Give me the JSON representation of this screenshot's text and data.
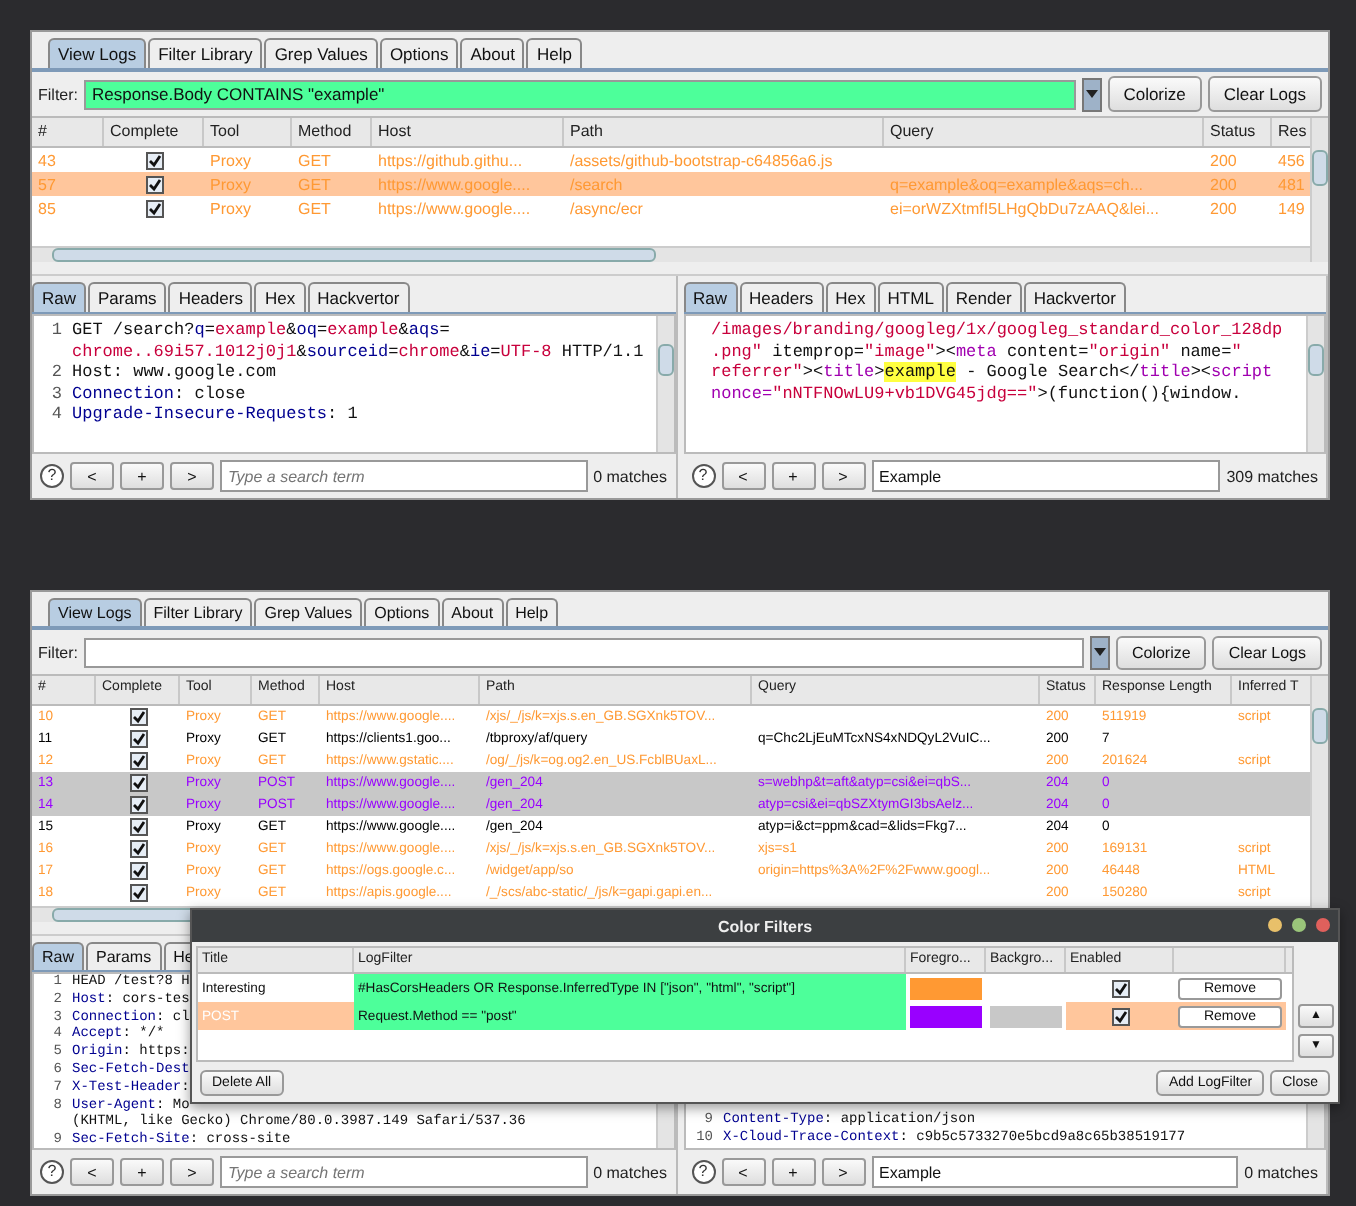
{
  "panels": [
    {
      "tabs": [
        {
          "label": "View Logs",
          "selected": true
        },
        {
          "label": "Filter Library",
          "selected": false
        },
        {
          "label": "Grep Values",
          "selected": false
        },
        {
          "label": "Options",
          "selected": false
        },
        {
          "label": "About",
          "selected": false
        },
        {
          "label": "Help",
          "selected": false
        }
      ],
      "filter": {
        "label": "Filter:",
        "value": "Response.Body CONTAINS \"example\"",
        "valid": true
      },
      "buttons": [
        "Colorize",
        "Clear Logs"
      ],
      "table": {
        "columns": [
          "#",
          "Complete",
          "Tool",
          "Method",
          "Host",
          "Path",
          "Query",
          "Status",
          "Res"
        ],
        "rows": [
          {
            "cells": [
              "43",
              "",
              "Proxy",
              "GET",
              "https://github.githu...",
              "/assets/github-bootstrap-c64856a6.js",
              "",
              "200",
              "456"
            ],
            "complete": true,
            "selected": false,
            "color": "#ff9933"
          },
          {
            "cells": [
              "57",
              "",
              "Proxy",
              "GET",
              "https://www.google....",
              "/search",
              "q=example&oq=example&aqs=ch...",
              "200",
              "481"
            ],
            "complete": true,
            "selected": true,
            "color": "#ff9933"
          },
          {
            "cells": [
              "85",
              "",
              "Proxy",
              "GET",
              "https://www.google....",
              "/async/ecr",
              "ei=orWZXtmfI5LHgQbDu7zAAQ&lei...",
              "200",
              "149"
            ],
            "complete": true,
            "selected": false,
            "color": "#ff9933"
          }
        ]
      },
      "request": {
        "tabs": [
          {
            "label": "Raw",
            "selected": true
          },
          {
            "label": "Params",
            "selected": false
          },
          {
            "label": "Headers",
            "selected": false
          },
          {
            "label": "Hex",
            "selected": false
          },
          {
            "label": "Hackvertor",
            "selected": false
          }
        ],
        "lines": [
          {
            "number": "1",
            "segments": [
              {
                "text": "GET /search?",
                "kind": "text"
              },
              {
                "text": "q",
                "kind": "name"
              },
              {
                "text": "=",
                "kind": "text"
              },
              {
                "text": "example",
                "kind": "value"
              },
              {
                "text": "&",
                "kind": "text"
              },
              {
                "text": "oq",
                "kind": "name"
              },
              {
                "text": "=",
                "kind": "text"
              },
              {
                "text": "example",
                "kind": "value"
              },
              {
                "text": "&",
                "kind": "text"
              },
              {
                "text": "aqs",
                "kind": "name"
              },
              {
                "text": "=",
                "kind": "text"
              }
            ]
          },
          {
            "segments": [
              {
                "text": "chrome..69i57.1012j0j1",
                "kind": "value"
              },
              {
                "text": "&",
                "kind": "text"
              },
              {
                "text": "sourceid",
                "kind": "name"
              },
              {
                "text": "=",
                "kind": "text"
              },
              {
                "text": "chrome",
                "kind": "value"
              },
              {
                "text": "&",
                "kind": "text"
              },
              {
                "text": "ie",
                "kind": "name"
              },
              {
                "text": "=",
                "kind": "text"
              },
              {
                "text": "UTF-8",
                "kind": "value"
              },
              {
                "text": " HTTP/1.1",
                "kind": "text"
              }
            ]
          },
          {
            "number": "2",
            "segments": [
              {
                "text": "Host: www.google.com",
                "kind": "text"
              }
            ]
          },
          {
            "number": "3",
            "segments": [
              {
                "text": "Connection",
                "kind": "name"
              },
              {
                "text": ": close",
                "kind": "text"
              }
            ]
          },
          {
            "number": "4",
            "segments": [
              {
                "text": "Upgrade-Insecure-Requests",
                "kind": "name"
              },
              {
                "text": ": 1",
                "kind": "text"
              }
            ]
          }
        ],
        "search": {
          "help": "?",
          "nav": [
            "<",
            "+",
            ">"
          ],
          "placeholder": "Type a search term",
          "matches": "0 matches"
        }
      },
      "response": {
        "tabs": [
          {
            "label": "Raw",
            "selected": true
          },
          {
            "label": "Headers",
            "selected": false
          },
          {
            "label": "Hex",
            "selected": false
          },
          {
            "label": "HTML",
            "selected": false
          },
          {
            "label": "Render",
            "selected": false
          },
          {
            "label": "Hackvertor",
            "selected": false
          }
        ],
        "lines": [
          {
            "segments": [
              {
                "text": "/images/branding/googleg/1x/googleg_standard_color_128dp",
                "kind": "value"
              }
            ]
          },
          {
            "segments": [
              {
                "text": ".png\"",
                "kind": "value"
              },
              {
                "text": " itemprop=",
                "kind": "text"
              },
              {
                "text": "\"image\"",
                "kind": "value"
              },
              {
                "text": "><",
                "kind": "text"
              },
              {
                "text": "meta",
                "kind": "tag"
              },
              {
                "text": " content=",
                "kind": "text"
              },
              {
                "text": "\"origin\"",
                "kind": "value"
              },
              {
                "text": " name=",
                "kind": "text"
              },
              {
                "text": "\"",
                "kind": "value"
              }
            ]
          },
          {
            "segments": [
              {
                "text": "referrer\"",
                "kind": "value"
              },
              {
                "text": "><",
                "kind": "text"
              },
              {
                "text": "title",
                "kind": "tag"
              },
              {
                "text": ">",
                "kind": "text"
              },
              {
                "text": "example",
                "kind": "match"
              },
              {
                "text": " - Google Search</",
                "kind": "text"
              },
              {
                "text": "title",
                "kind": "tag"
              },
              {
                "text": "><",
                "kind": "text"
              },
              {
                "text": "script",
                "kind": "tag"
              }
            ]
          },
          {
            "segments": [
              {
                "text": "nonce=",
                "kind": "tag"
              },
              {
                "text": "\"nNTFNOwLU9+vb1DVG45jdg==\"",
                "kind": "value"
              },
              {
                "text": ">(function(){window.",
                "kind": "text"
              }
            ]
          }
        ],
        "search": {
          "help": "?",
          "nav": [
            "<",
            "+",
            ">"
          ],
          "value": "Example",
          "matches": "309 matches"
        }
      }
    },
    {
      "tabs": [
        {
          "label": "View Logs",
          "selected": true
        },
        {
          "label": "Filter Library",
          "selected": false
        },
        {
          "label": "Grep Values",
          "selected": false
        },
        {
          "label": "Options",
          "selected": false
        },
        {
          "label": "About",
          "selected": false
        },
        {
          "label": "Help",
          "selected": false
        }
      ],
      "filter": {
        "label": "Filter:",
        "valid": false
      },
      "buttons": [
        "Colorize",
        "Clear Logs"
      ],
      "table": {
        "columns": [
          "#",
          "Complete",
          "Tool",
          "Method",
          "Host",
          "Path",
          "Query",
          "Status",
          "Response Length",
          "Inferred T"
        ],
        "rows": [
          {
            "cells": [
              "10",
              "",
              "Proxy",
              "GET",
              "https://www.google....",
              "/xjs/_/js/k=xjs.s.en_GB.SGXnk5TOV...",
              "",
              "200",
              "511919",
              "script"
            ],
            "complete": true,
            "selected": false,
            "color": "#ff9933"
          },
          {
            "cells": [
              "11",
              "",
              "Proxy",
              "GET",
              "https://clients1.goo...",
              "/tbproxy/af/query",
              "q=Chc2LjEuMTcxNS4xNDQyL2VuIC...",
              "200",
              "7",
              ""
            ],
            "complete": true,
            "selected": false,
            "color": "#000000"
          },
          {
            "cells": [
              "12",
              "",
              "Proxy",
              "GET",
              "https://www.gstatic....",
              "/og/_/js/k=og.og2.en_US.FcblBUaxL...",
              "",
              "200",
              "201624",
              "script"
            ],
            "complete": true,
            "selected": false,
            "color": "#ff9933"
          },
          {
            "cells": [
              "13",
              "",
              "Proxy",
              "POST",
              "https://www.google....",
              "/gen_204",
              "s=webhp&t=aft&atyp=csi&ei=qbS...",
              "204",
              "0",
              ""
            ],
            "complete": true,
            "selected": false,
            "color": "#9900ff",
            "background": {
              "color": "#c8c8c8"
            }
          },
          {
            "cells": [
              "14",
              "",
              "Proxy",
              "POST",
              "https://www.google....",
              "/gen_204",
              "atyp=csi&ei=qbSZXtymGI3bsAelz...",
              "204",
              "0",
              ""
            ],
            "complete": true,
            "selected": false,
            "color": "#9900ff",
            "background": {
              "color": "#c8c8c8"
            }
          },
          {
            "cells": [
              "15",
              "",
              "Proxy",
              "GET",
              "https://www.google....",
              "/gen_204",
              "atyp=i&ct=ppm&cad=&lids=Fkg7...",
              "204",
              "0",
              ""
            ],
            "complete": true,
            "selected": false,
            "color": "#000000"
          },
          {
            "cells": [
              "16",
              "",
              "Proxy",
              "GET",
              "https://www.google....",
              "/xjs/_/js/k=xjs.s.en_GB.SGXnk5TOV...",
              "xjs=s1",
              "200",
              "169131",
              "script"
            ],
            "complete": true,
            "selected": false,
            "color": "#ff9933"
          },
          {
            "cells": [
              "17",
              "",
              "Proxy",
              "GET",
              "https://ogs.google.c...",
              "/widget/app/so",
              "origin=https%3A%2F%2Fwww.googl...",
              "200",
              "46448",
              "HTML"
            ],
            "complete": true,
            "selected": false,
            "color": "#ff9933"
          },
          {
            "cells": [
              "18",
              "",
              "Proxy",
              "GET",
              "https://apis.google....",
              "/_/scs/abc-static/_/js/k=gapi.gapi.en...",
              "",
              "200",
              "150280",
              "script"
            ],
            "complete": true,
            "selected": false,
            "color": "#ff9933"
          }
        ]
      },
      "request": {
        "tabs": [
          {
            "label": "Raw",
            "selected": true
          },
          {
            "label": "Params",
            "selected": false
          },
          {
            "label": "He",
            "selected": false
          }
        ],
        "lines": [
          {
            "number": "1",
            "segments": [
              {
                "text": "HEAD /test?8 H",
                "kind": "text"
              }
            ]
          },
          {
            "number": "2",
            "segments": [
              {
                "text": "Host",
                "kind": "name"
              },
              {
                "text": ": cors-tes",
                "kind": "text"
              }
            ]
          },
          {
            "number": "3",
            "segments": [
              {
                "text": "Connection",
                "kind": "name"
              },
              {
                "text": ": cl",
                "kind": "text"
              }
            ]
          },
          {
            "number": "4",
            "segments": [
              {
                "text": "Accept",
                "kind": "name"
              },
              {
                "text": ": */*",
                "kind": "text"
              }
            ]
          },
          {
            "number": "5",
            "segments": [
              {
                "text": "Origin",
                "kind": "name"
              },
              {
                "text": ": https:",
                "kind": "text"
              }
            ]
          },
          {
            "number": "6",
            "segments": [
              {
                "text": "Sec-Fetch-Dest",
                "kind": "name"
              }
            ]
          },
          {
            "number": "7",
            "segments": [
              {
                "text": "X-Test-Header",
                "kind": "name"
              },
              {
                "text": ":",
                "kind": "text"
              }
            ]
          },
          {
            "number": "8",
            "segments": [
              {
                "text": "User-Agent",
                "kind": "name"
              },
              {
                "text": ": Mo",
                "kind": "text"
              }
            ]
          },
          {
            "segments": [
              {
                "text": "(KHTML, like Gecko) Chrome/80.0.3987.149 Safari/537.36",
                "kind": "text"
              }
            ]
          },
          {
            "number": "9",
            "segments": [
              {
                "text": "Sec-Fetch-Site",
                "kind": "name"
              },
              {
                "text": ": cross-site",
                "kind": "text"
              }
            ]
          }
        ],
        "search": {
          "help": "?",
          "nav": [
            "<",
            "+",
            ">"
          ],
          "placeholder": "Type a search term",
          "matches": "0 matches"
        }
      },
      "response": {
        "lines": [
          {
            "number": "9",
            "segments": [
              {
                "text": "Content-Type",
                "kind": "name"
              },
              {
                "text": ": application/json",
                "kind": "text"
              }
            ]
          },
          {
            "number": "10",
            "segments": [
              {
                "text": "X-Cloud-Trace-Context",
                "kind": "name"
              },
              {
                "text": ": c9b5c5733270e5bcd9a8c65b38519177",
                "kind": "text"
              }
            ]
          }
        ],
        "search": {
          "help": "?",
          "nav": [
            "<",
            "+",
            ">"
          ],
          "value": "Example",
          "matches": "0 matches"
        }
      }
    }
  ],
  "dialog": {
    "title": "Color Filters",
    "columns": [
      "Title",
      "LogFilter",
      "Foregro...",
      "Backgro...",
      "Enabled"
    ],
    "rows": [
      {
        "title": "Interesting",
        "filter": "#HasCorsHeaders OR Response.InferredType IN [\"json\", \"html\", \"script\"]",
        "valid": true,
        "foreground": {
          "color": "#ff9933"
        },
        "enabled": true,
        "selected": false,
        "action": "Remove"
      },
      {
        "title": "POST",
        "filter": "Request.Method == \"post\"",
        "valid": true,
        "foreground": {
          "color": "#9900ff"
        },
        "background": {
          "color": "#c8c8c8"
        },
        "enabled": true,
        "selected": true,
        "action": "Remove"
      }
    ],
    "move": [
      "▲",
      "▼"
    ],
    "left_buttons": [
      "Delete All"
    ],
    "right_buttons": [
      "Add LogFilter",
      "Close"
    ]
  }
}
